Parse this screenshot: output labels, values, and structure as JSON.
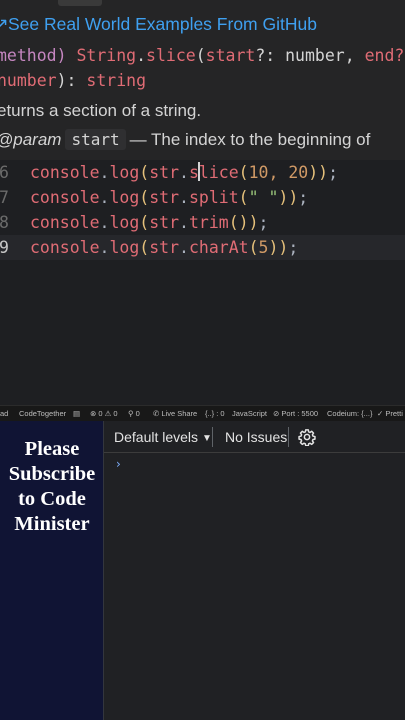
{
  "tooltip": {
    "link_text": "See Real World Examples From GitHub",
    "signature_line1": {
      "kind": "method)",
      "owner": "String",
      "method": "slice",
      "open": "(",
      "param1": "start",
      "param1_type": "?: number,",
      "param2": "end?:"
    },
    "signature_line2": {
      "param2_type": "number",
      "close": "): ",
      "return_type": "string"
    },
    "description": "eturns a section of a string.",
    "param_tag": "param",
    "param_name": "start",
    "param_desc": "— The index to the beginning of"
  },
  "editor": {
    "lines": [
      {
        "number": "6",
        "obj": "console",
        "fn": "log",
        "target": "str",
        "call": "slice",
        "args": "10, 20",
        "args_kind": "num"
      },
      {
        "number": "7",
        "obj": "console",
        "fn": "log",
        "target": "str",
        "call": "split",
        "args": "\" \"",
        "args_kind": "str"
      },
      {
        "number": "8",
        "obj": "console",
        "fn": "log",
        "target": "str",
        "call": "trim",
        "args": "",
        "args_kind": "none"
      },
      {
        "number": "9",
        "obj": "console",
        "fn": "log",
        "target": "str",
        "call": "charAt",
        "args": "5",
        "args_kind": "num"
      }
    ]
  },
  "statusbar": {
    "items": [
      "ad",
      "CodeTogether",
      "▤",
      "⊗ 0 ⚠ 0",
      "⚲ 0",
      "✆ Live Share",
      "{..} : 0",
      "JavaScript",
      "⊘ Port : 5500",
      "Codeium: {...}",
      "✓ Pretti"
    ]
  },
  "subscribe": {
    "text": "Please Subscribe to Code Minister"
  },
  "console": {
    "levels_label": "Default levels",
    "issues_label": "No Issues",
    "prompt_symbol": "›"
  },
  "colors": {
    "link": "#3fa0f0",
    "identifier": "#e06c75",
    "string": "#98c379",
    "number": "#d19a66",
    "paren": "#e5c07b",
    "subscribe_bg": "#101434"
  },
  "icons": {
    "tooltip_link": "arrow-icon",
    "console_settings": "gear-icon",
    "levels_dropdown": "caret-down-icon"
  }
}
